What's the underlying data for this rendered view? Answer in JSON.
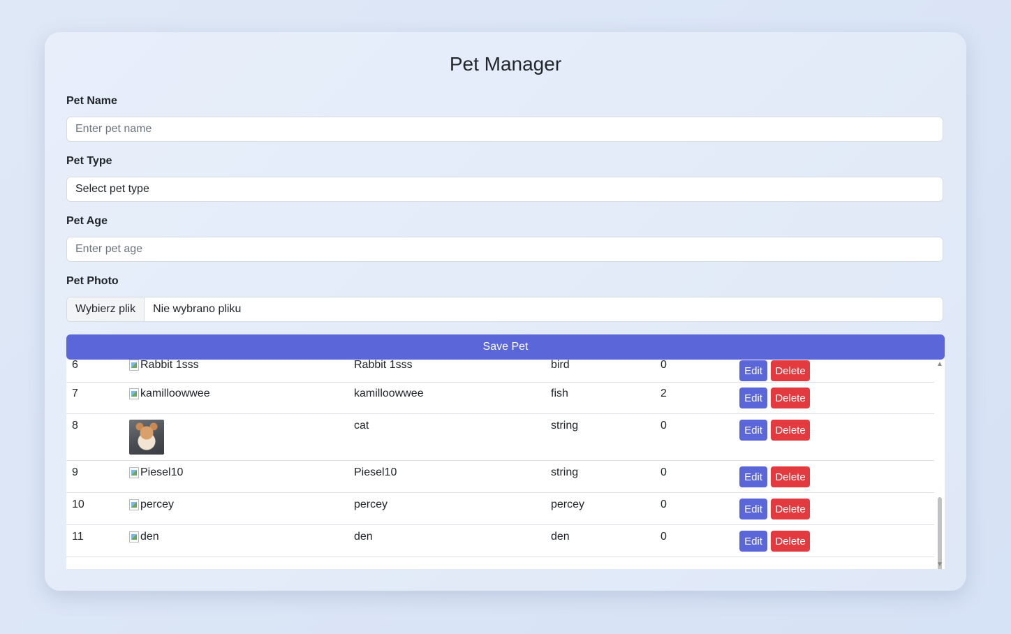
{
  "app": {
    "title": "Pet Manager"
  },
  "form": {
    "name": {
      "label": "Pet Name",
      "placeholder": "Enter pet name"
    },
    "type": {
      "label": "Pet Type",
      "selected": "Select pet type"
    },
    "age": {
      "label": "Pet Age",
      "placeholder": "Enter pet age"
    },
    "photo": {
      "label": "Pet Photo",
      "button": "Wybierz plik",
      "status": "Nie wybrano pliku"
    },
    "save_label": "Save Pet"
  },
  "table": {
    "edit_label": "Edit",
    "delete_label": "Delete",
    "rows": [
      {
        "id": "6",
        "photo_alt": "Rabbit 1sss",
        "name": "Rabbit 1sss",
        "type": "bird",
        "age": "0"
      },
      {
        "id": "7",
        "photo_alt": "kamilloowwee",
        "name": "kamilloowwee",
        "type": "fish",
        "age": "2"
      },
      {
        "id": "8",
        "photo_alt": "",
        "name": "cat",
        "type": "string",
        "age": "0"
      },
      {
        "id": "9",
        "photo_alt": "Piesel10",
        "name": "Piesel10",
        "type": "string",
        "age": "0"
      },
      {
        "id": "10",
        "photo_alt": "percey",
        "name": "percey",
        "type": "percey",
        "age": "0"
      },
      {
        "id": "11",
        "photo_alt": "den",
        "name": "den",
        "type": "den",
        "age": "0"
      }
    ]
  },
  "colors": {
    "primary": "#5b67d8",
    "danger": "#e33a3f",
    "background": "#dfe8f6"
  }
}
